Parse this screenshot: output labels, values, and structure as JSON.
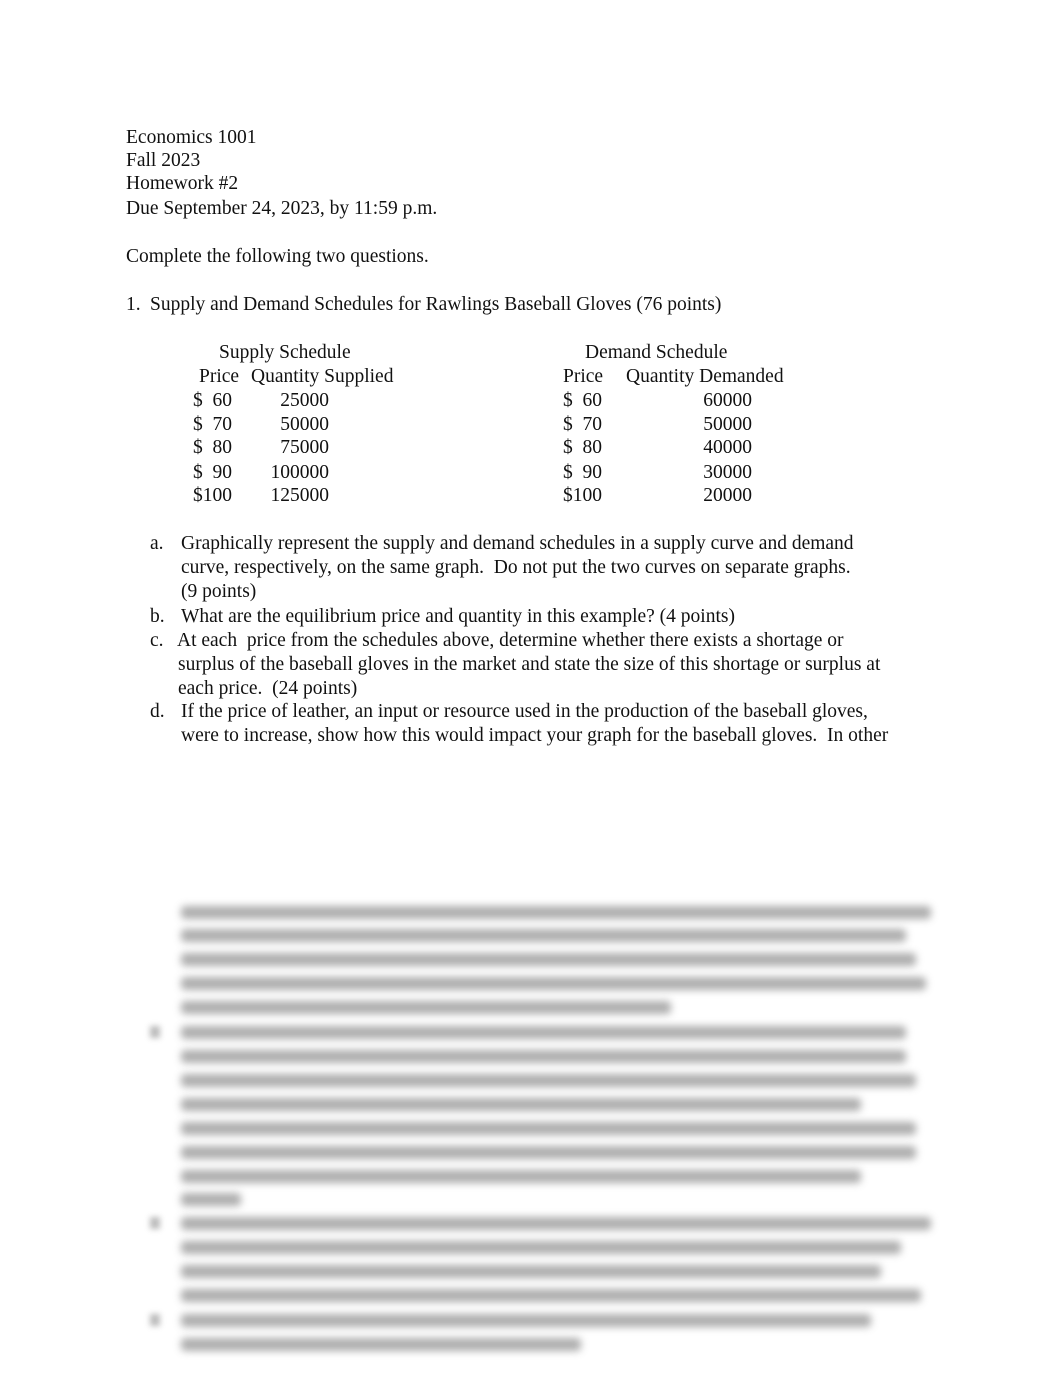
{
  "header": {
    "course": "Economics 1001",
    "term": "Fall 2023",
    "assignment": "Homework #2",
    "due": "Due September 24, 2023, by 11:59 p.m."
  },
  "instructions": "Complete the following two questions.",
  "question1": {
    "number": "1.",
    "title": "Supply and Demand Schedules for Rawlings Baseball Gloves (76 points)",
    "supply": {
      "title": "Supply Schedule",
      "price_header": "Price",
      "qty_header": "Quantity Supplied",
      "rows": [
        {
          "price": "$  60",
          "qty": "25000"
        },
        {
          "price": "$  70",
          "qty": "50000"
        },
        {
          "price": "$  80",
          "qty": "75000"
        },
        {
          "price": "$  90",
          "qty": "100000"
        },
        {
          "price": "$100",
          "qty": "125000"
        }
      ]
    },
    "demand": {
      "title": "Demand Schedule",
      "price_header": "Price",
      "qty_header": "Quantity Demanded",
      "rows": [
        {
          "price": "$  60",
          "qty": "60000"
        },
        {
          "price": "$  70",
          "qty": "50000"
        },
        {
          "price": "$  80",
          "qty": "40000"
        },
        {
          "price": "$  90",
          "qty": "30000"
        },
        {
          "price": "$100",
          "qty": "20000"
        }
      ]
    },
    "parts": [
      {
        "label": "a.",
        "lines": [
          "Graphically represent the supply and demand schedules in a supply curve and demand",
          "curve, respectively, on the same graph.  Do not put the two curves on separate graphs.",
          "(9 points)"
        ]
      },
      {
        "label": "b.",
        "lines": [
          "What are the equilibrium price and quantity in this example? (4 points)"
        ]
      },
      {
        "label": "c.",
        "lines": [
          "At each  price from the schedules above, determine whether there exists a shortage or",
          "surplus of the baseball gloves in the market and state the size of this shortage or surplus at",
          "each price.  (24 points)"
        ]
      },
      {
        "label": "d.",
        "lines": [
          "If the price of leather, an input or resource used in the production of the baseball gloves,",
          "were to increase, show how this would impact your graph for the baseball gloves.  In other"
        ]
      }
    ]
  }
}
